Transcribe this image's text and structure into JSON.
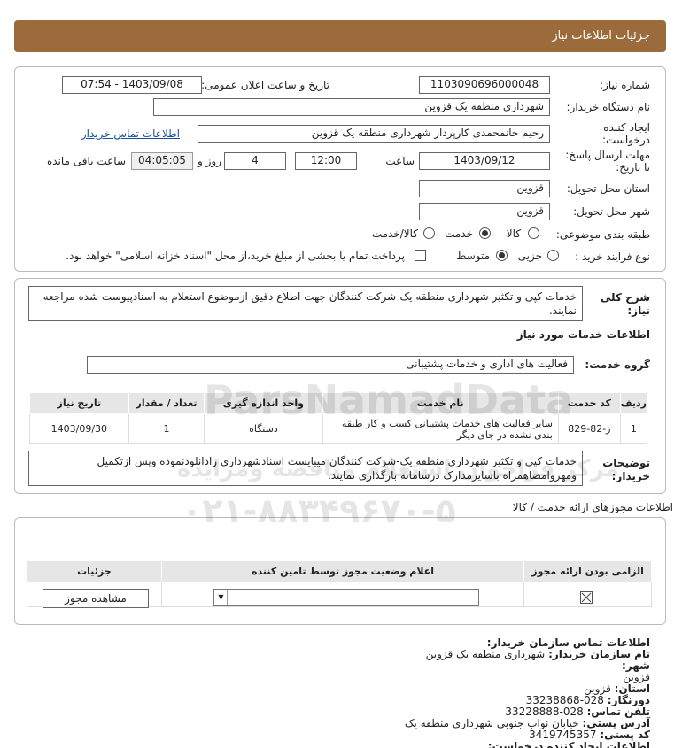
{
  "header": {
    "title": "جزئیات اطلاعات نیاز"
  },
  "form": {
    "need_number": {
      "label": "شماره نیاز:",
      "value": "1103090696000048"
    },
    "announce": {
      "label": "تاریخ و ساعت اعلان عمومی:",
      "value": "1403/09/08 - 07:54"
    },
    "buyer_org": {
      "label": "نام دستگاه خریدار:",
      "value": "شهرداری منطقه یک قزوین"
    },
    "creator": {
      "label_line1": "ایجاد کننده",
      "label_line2": "درخواست:",
      "value": "رحیم خانمحمدی کارپرداز شهرداری منطقه یک قزوین",
      "contact_link": "اطلاعات تماس خریدار"
    },
    "deadline": {
      "label_line1": "مهلت ارسال پاسخ:",
      "label_line2": "تا تاریخ:",
      "date": "1403/09/12",
      "time_label": "ساعت",
      "time": "12:00",
      "days": "4",
      "days_label": "روز و",
      "remaining": "04:05:05",
      "remaining_label": "ساعت باقی مانده"
    },
    "province": {
      "label": "استان محل تحویل:",
      "value": "قزوین"
    },
    "city": {
      "label": "شهر محل تحویل:",
      "value": "قزوین"
    },
    "category": {
      "label": "طبقه بندی موضوعی:",
      "options": [
        "کالا",
        "خدمت",
        "کالا/خدمت"
      ],
      "selected": "خدمت"
    },
    "process": {
      "label": "نوع فرآیند خرید :",
      "options": [
        "جزیی",
        "متوسط"
      ],
      "selected": "متوسط",
      "payment_note": "پرداخت تمام یا بخشی از مبلغ خرید،از محل \"اسناد خزانه اسلامی\" خواهد بود."
    }
  },
  "summary": {
    "label_line1": "شرح کلی",
    "label_line2": "نیاز:",
    "text": "خدمات کپی و تکثیر شهرداری منطقه یک-شرکت کنندگان جهت اطلاع دقیق ازموضوع استعلام به اسنادپیوست شده مراجعه نمایند."
  },
  "services": {
    "section_title": "اطلاعات خدمات مورد نیاز",
    "group_label": "گروه خدمت:",
    "group_value": "فعالیت های اداری و خدمات پشتیبانی",
    "table": {
      "headers": [
        "ردیف",
        "کد خدمت",
        "نام خدمت",
        "واحد اندازه گیری",
        "تعداد / مقدار",
        "تاریخ نیاز"
      ],
      "rows": [
        {
          "index": "1",
          "code": "ز-82-829",
          "name": "سایر فعالیت های خدمات پشتیبانی کسب و کار طبقه بندی نشده در جای دیگر",
          "unit": "دستگاه",
          "qty": "1",
          "date": "1403/09/30"
        }
      ]
    }
  },
  "buyer_notes": {
    "label_line1": "توضیحات",
    "label_line2": "خریدار:",
    "text": "خدمات کپی و تکثیر شهرداری منطقه یک-شرکت کنندگان میبایست اسنادشهرداری رادانلودنموده وپس ازتکمیل ومهروامضاهمراه باسایرمدارک درسامانه بارگذاری نمایند."
  },
  "permits": {
    "section_title": "اطلاعات مجوزهای ارائه خدمت / کالا",
    "headers": [
      "الزامی بودن ارائه مجوز",
      "اعلام وضعیت مجوز توسط تامین کننده",
      "جزئیات"
    ],
    "row": {
      "select_value": "--",
      "view_button": "مشاهده مجوز"
    }
  },
  "contact": {
    "title": "اطلاعات تماس سازمان خریدار:",
    "org_label": "نام سازمان خریدار:",
    "org": "شهرداری منطقه یک قزوین",
    "city_label": "شهر:",
    "city": "قزوین",
    "province_label": "استان:",
    "province": "قزوین",
    "fax_label": "دورنگار:",
    "fax": "028-33238868",
    "phone_label": "تلفن تماس:",
    "phone": "028-33228888",
    "address_label": "آدرس پستی:",
    "address": "خیابان نواب جنوبی شهرداری منطقه یک",
    "postal_label": "کد پستی:",
    "postal": "3419745357",
    "creator_title": "اطلاعات ایجاد کننده درخواست:"
  },
  "watermark": {
    "brand": "ParsNamadData",
    "tagline": "مرکز فراخوان استعلام مناقصه ومزایده",
    "phone": "۰۲۱-۸۸۳۴۹۶۷۰-۵"
  }
}
